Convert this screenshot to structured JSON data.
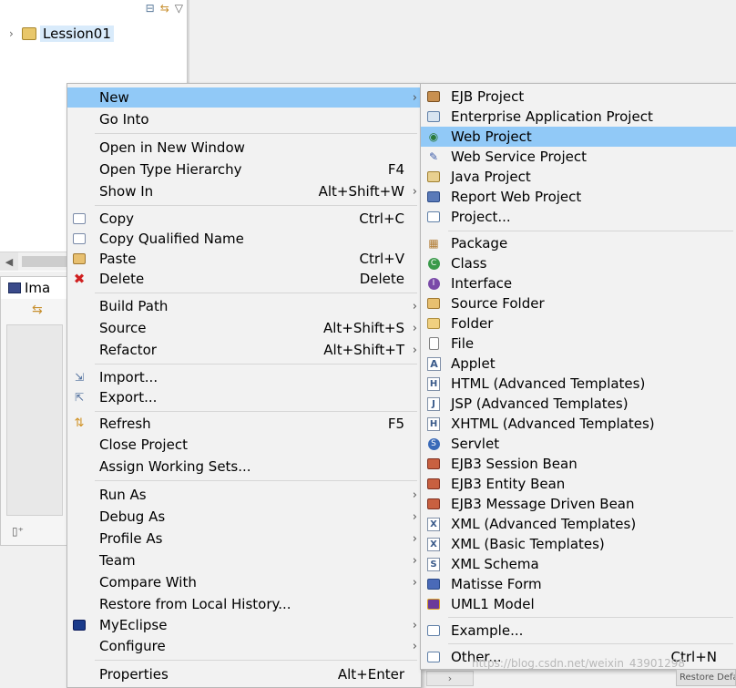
{
  "explorer": {
    "project_name": "Lession01"
  },
  "lower_view": {
    "tab_label": "Ima"
  },
  "context_menu": {
    "items": [
      {
        "label": "New",
        "accel": ""
      },
      {
        "label": "Go Into",
        "accel": ""
      },
      {
        "label": "Open in New Window",
        "accel": ""
      },
      {
        "label": "Open Type Hierarchy",
        "accel": "F4"
      },
      {
        "label": "Show In",
        "accel": "Alt+Shift+W"
      },
      {
        "label": "Copy",
        "accel": "Ctrl+C"
      },
      {
        "label": "Copy Qualified Name",
        "accel": ""
      },
      {
        "label": "Paste",
        "accel": "Ctrl+V"
      },
      {
        "label": "Delete",
        "accel": "Delete"
      },
      {
        "label": "Build Path",
        "accel": ""
      },
      {
        "label": "Source",
        "accel": "Alt+Shift+S"
      },
      {
        "label": "Refactor",
        "accel": "Alt+Shift+T"
      },
      {
        "label": "Import...",
        "accel": ""
      },
      {
        "label": "Export...",
        "accel": ""
      },
      {
        "label": "Refresh",
        "accel": "F5"
      },
      {
        "label": "Close Project",
        "accel": ""
      },
      {
        "label": "Assign Working Sets...",
        "accel": ""
      },
      {
        "label": "Run As",
        "accel": ""
      },
      {
        "label": "Debug As",
        "accel": ""
      },
      {
        "label": "Profile As",
        "accel": ""
      },
      {
        "label": "Team",
        "accel": ""
      },
      {
        "label": "Compare With",
        "accel": ""
      },
      {
        "label": "Restore from Local History...",
        "accel": ""
      },
      {
        "label": "MyEclipse",
        "accel": ""
      },
      {
        "label": "Configure",
        "accel": ""
      },
      {
        "label": "Properties",
        "accel": "Alt+Enter"
      }
    ]
  },
  "new_submenu": {
    "items": [
      {
        "label": "EJB Project"
      },
      {
        "label": "Enterprise Application Project"
      },
      {
        "label": "Web Project"
      },
      {
        "label": "Web Service Project"
      },
      {
        "label": "Java Project"
      },
      {
        "label": "Report Web Project"
      },
      {
        "label": "Project..."
      },
      {
        "label": "Package"
      },
      {
        "label": "Class"
      },
      {
        "label": "Interface"
      },
      {
        "label": "Source Folder"
      },
      {
        "label": "Folder"
      },
      {
        "label": "File"
      },
      {
        "label": "Applet"
      },
      {
        "label": "HTML (Advanced Templates)"
      },
      {
        "label": "JSP (Advanced Templates)"
      },
      {
        "label": "XHTML (Advanced Templates)"
      },
      {
        "label": "Servlet"
      },
      {
        "label": "EJB3 Session Bean"
      },
      {
        "label": "EJB3 Entity Bean"
      },
      {
        "label": "EJB3 Message Driven Bean"
      },
      {
        "label": "XML (Advanced Templates)"
      },
      {
        "label": "XML (Basic Templates)"
      },
      {
        "label": "XML Schema"
      },
      {
        "label": "Matisse Form"
      },
      {
        "label": "UML1 Model"
      },
      {
        "label": "Example..."
      },
      {
        "label": "Other...",
        "accel": "Ctrl+N"
      }
    ]
  },
  "watermark": "https://blog.csdn.net/weixin_43901298",
  "restore_button": "Restore Default"
}
